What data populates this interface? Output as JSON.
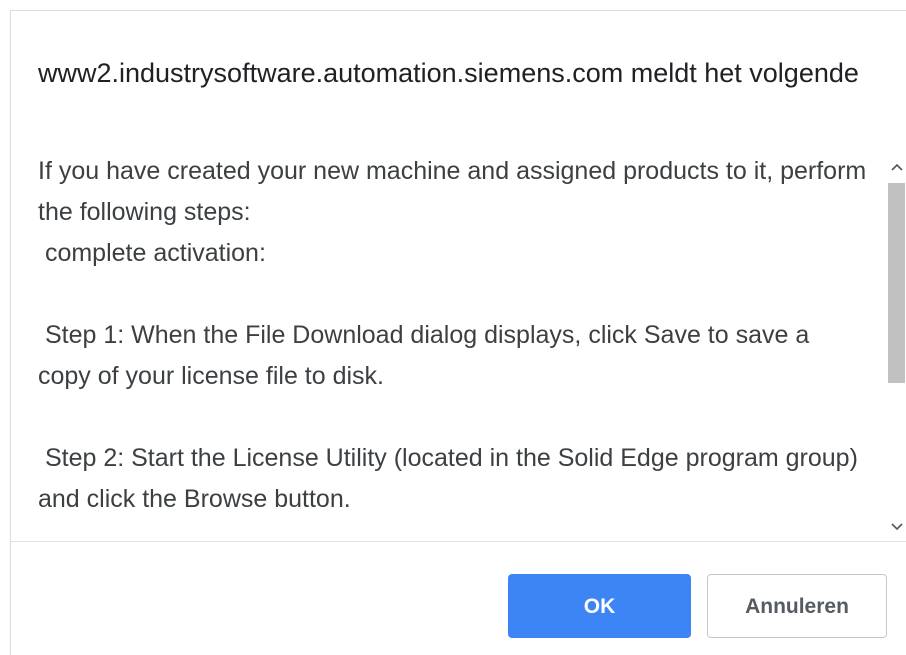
{
  "dialog": {
    "title": "www2.industrysoftware.automation.siemens.com meldt het volgende",
    "message": "If you have created your new machine and assigned products to it, perform the following steps:\n complete activation:\n\n Step 1: When the File Download dialog displays, click Save to save a copy of your license file to disk.\n\n Step 2: Start the License Utility (located in the Solid Edge program group) and click the Browse button.",
    "ok_label": "OK",
    "cancel_label": "Annuleren"
  },
  "icons": {
    "scroll_up": "chevron-up-icon",
    "scroll_down": "chevron-down-icon"
  },
  "colors": {
    "primary": "#3d85f5",
    "scrollbar_thumb": "#c1c1c1"
  }
}
